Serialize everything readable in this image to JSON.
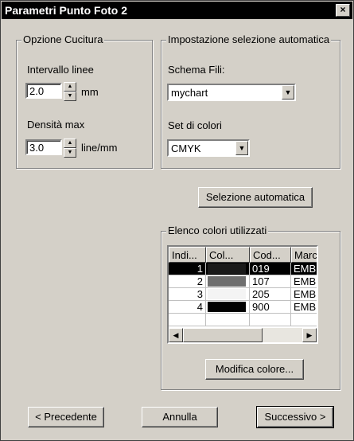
{
  "window": {
    "title": "Parametri Punto Foto 2",
    "close": "×"
  },
  "stitch": {
    "legend": "Opzione Cucitura",
    "interval_label": "Intervallo linee",
    "interval_value": "2.0",
    "interval_unit": "mm",
    "density_label": "Densità max",
    "density_value": "3.0",
    "density_unit": "line/mm"
  },
  "auto": {
    "legend": "Impostazione selezione automatica",
    "scheme_label": "Schema Fili:",
    "scheme_value": "mychart",
    "colorset_label": "Set di colori",
    "colorset_value": "CMYK",
    "auto_button": "Selezione automatica"
  },
  "colors": {
    "legend": "Elenco colori utilizzati",
    "columns": [
      "Indi...",
      "Col...",
      "Cod...",
      "Marca"
    ],
    "rows": [
      {
        "index": "1",
        "swatch": "#1a1a1a",
        "code": "019",
        "brand": "EMBROI",
        "selected": true
      },
      {
        "index": "2",
        "swatch": "#6e6e6e",
        "code": "107",
        "brand": "EMBROI",
        "selected": false
      },
      {
        "index": "3",
        "swatch": "#f4f4f4",
        "code": "205",
        "brand": "EMBROI",
        "selected": false
      },
      {
        "index": "4",
        "swatch": "#000000",
        "code": "900",
        "brand": "EMBROI",
        "selected": false
      }
    ],
    "modify_button": "Modifica colore..."
  },
  "footer": {
    "prev": "< Precedente",
    "cancel": "Annulla",
    "next": "Successivo >"
  }
}
